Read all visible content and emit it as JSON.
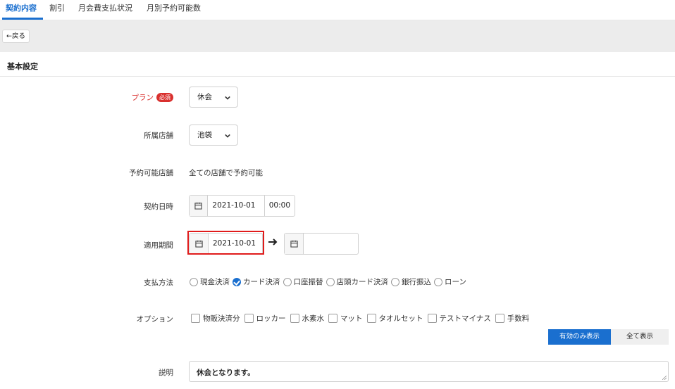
{
  "tabs": [
    "契約内容",
    "割引",
    "月会費支払状況",
    "月別予約可能数"
  ],
  "back_label": "←戻る",
  "section_title": "基本設定",
  "plan": {
    "label": "プラン",
    "required_badge": "必須",
    "value": "休会"
  },
  "store": {
    "label": "所属店舗",
    "value": "池袋"
  },
  "bookable_stores": {
    "label": "予約可能店舗",
    "value": "全ての店舗で予約可能"
  },
  "contract_datetime": {
    "label": "契約日時",
    "date": "2021-10-01",
    "time": "00:00"
  },
  "period": {
    "label": "適用期間",
    "start": "2021-10-01",
    "end": ""
  },
  "payment": {
    "label": "支払方法",
    "options": [
      "現金決済",
      "カード決済",
      "口座振替",
      "店頭カード決済",
      "銀行振込",
      "ローン"
    ],
    "selected": "カード決済"
  },
  "options": {
    "label": "オプション",
    "items": [
      "物販決済分",
      "ロッカー",
      "水素水",
      "マット",
      "タオルセット",
      "テストマイナス",
      "手数料"
    ],
    "toggle_active": "有効のみ表示",
    "toggle_all": "全て表示"
  },
  "description": {
    "label": "説明",
    "value": "休会となります。"
  },
  "colors": {
    "accent": "#1a6fcf",
    "required": "#d9302e",
    "highlight": "#e01b1b"
  }
}
